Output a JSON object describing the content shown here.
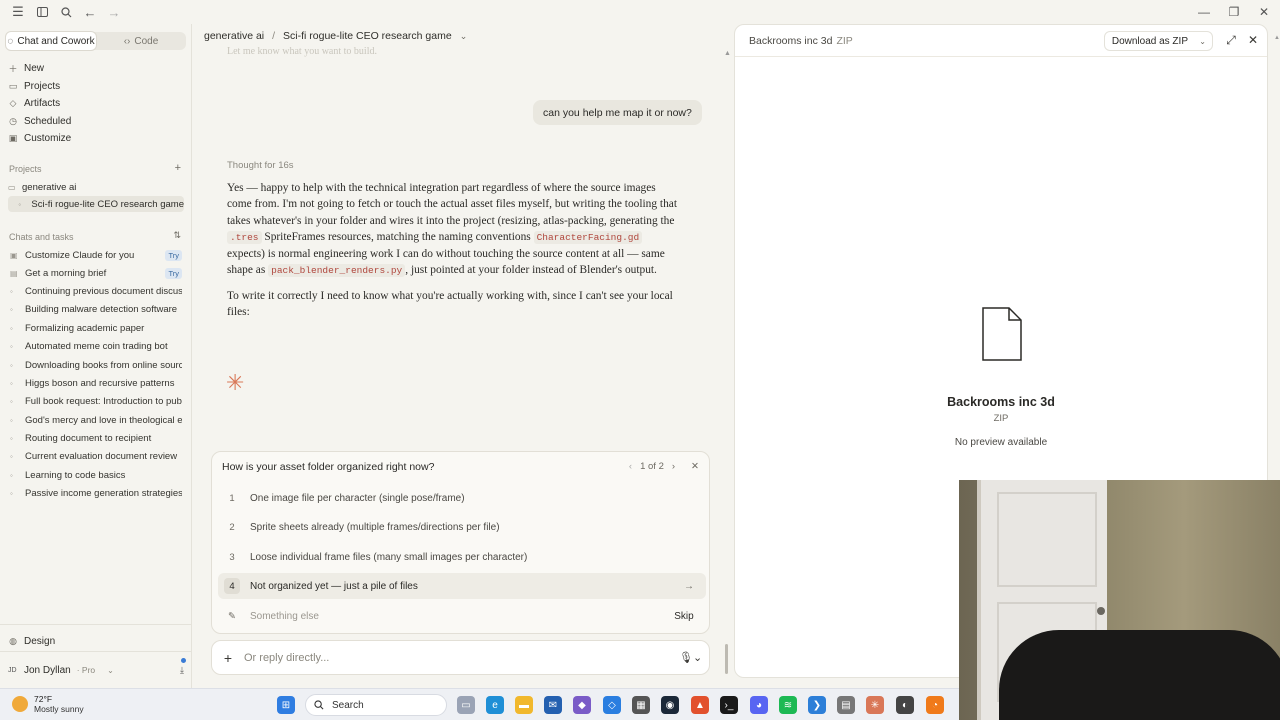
{
  "app": {
    "modes": [
      {
        "label": "Chat and Cowork",
        "active": true
      },
      {
        "label": "Code",
        "active": false
      }
    ]
  },
  "nav": [
    {
      "label": "New",
      "icon": "plus-icon"
    },
    {
      "label": "Projects",
      "icon": "folder-icon"
    },
    {
      "label": "Artifacts",
      "icon": "artifacts-icon"
    },
    {
      "label": "Scheduled",
      "icon": "clock-icon"
    },
    {
      "label": "Customize",
      "icon": "customize-icon"
    }
  ],
  "projects": {
    "title": "Projects",
    "items": [
      {
        "label": "generative ai",
        "active": false
      },
      {
        "label": "Sci-fi rogue-lite CEO research game",
        "active": true
      }
    ]
  },
  "chats": {
    "title": "Chats and tasks",
    "items": [
      {
        "label": "Customize Claude for you",
        "badge": "Try"
      },
      {
        "label": "Get a morning brief",
        "badge": "Try"
      },
      {
        "label": "Continuing previous document discussion"
      },
      {
        "label": "Building malware detection software"
      },
      {
        "label": "Formalizing academic paper"
      },
      {
        "label": "Automated meme coin trading bot"
      },
      {
        "label": "Downloading books from online sources"
      },
      {
        "label": "Higgs boson and recursive patterns"
      },
      {
        "label": "Full book request: Introduction to public"
      },
      {
        "label": "God's mercy and love in theological ev"
      },
      {
        "label": "Routing document to recipient"
      },
      {
        "label": "Current evaluation document review"
      },
      {
        "label": "Learning to code basics"
      },
      {
        "label": "Passive income generation strategies"
      }
    ]
  },
  "sidebar_bottom": {
    "design": "Design",
    "user_initials": "JD",
    "user_name": "Jon Dyllan",
    "plan": "· Pro"
  },
  "header": {
    "project": "generative ai",
    "separator": "/",
    "chat_title": "Sci-fi rogue-lite CEO research game"
  },
  "conversation": {
    "faded_text": "Let me know what you want to build.",
    "user_message": "can you help me map it or now?",
    "thought": "Thought for 16s",
    "p1_a": "Yes — happy to help with the technical integration part regardless of where the source images come from. I'm not going to fetch or touch the actual asset files myself, but writing the tooling that takes whatever's in your folder and wires it into the project (resizing, atlas-packing, generating the ",
    "code1": ".tres",
    "p1_b": " SpriteFrames resources, matching the naming conventions ",
    "code2": "CharacterFacing.gd",
    "p1_c": " expects) is normal engineering work I can do without touching the source content at all — same shape as ",
    "code3": "pack_blender_renders.py",
    "p1_d": ", just pointed at your folder instead of Blender's output.",
    "p2": "To write it correctly I need to know what you're actually working with, since I can't see your local files:"
  },
  "question": {
    "title": "How is your asset folder organized right now?",
    "pager": "1 of 2",
    "options": [
      {
        "num": "1",
        "label": "One image file per character (single pose/frame)"
      },
      {
        "num": "2",
        "label": "Sprite sheets already (multiple frames/directions per file)"
      },
      {
        "num": "3",
        "label": "Loose individual frame files (many small images per character)"
      },
      {
        "num": "4",
        "label": "Not organized yet — just a pile of files",
        "selected": true
      }
    ],
    "other_placeholder": "Something else",
    "skip": "Skip"
  },
  "composer": {
    "placeholder": "Or reply directly..."
  },
  "artifact": {
    "title": "Backrooms inc 3d",
    "type": "ZIP",
    "download": "Download as ZIP",
    "name": "Backrooms inc 3d",
    "type_label": "ZIP",
    "no_preview": "No preview available"
  },
  "taskbar": {
    "temp": "72°F",
    "weather": "Mostly sunny",
    "search": "Search"
  },
  "colors": {
    "accent": "#d97757",
    "selected_option": "#eeece5",
    "try_badge": "#dce6f2"
  }
}
